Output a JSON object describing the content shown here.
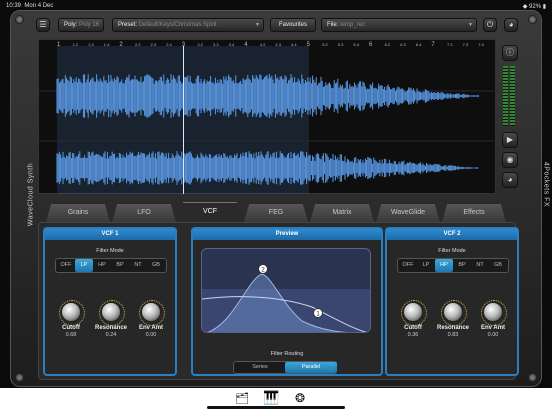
{
  "status": {
    "time": "10:39",
    "date": "Mon 4 Dec",
    "battery": "92%"
  },
  "topbar": {
    "menu_icon": "hamburger-icon",
    "poly_label": "Poly:",
    "poly_value": "Poly 16",
    "preset_label": "Preset:",
    "preset_value": "Default/Keys/Christmas Spirit",
    "favourites_label": "Favourites",
    "file_label": "File:",
    "file_value": "temp_rec"
  },
  "side_labels": {
    "left": "WaveCloud Synth",
    "right": "4Pockets FX"
  },
  "ruler": [
    "1",
    "1.2",
    "1.3",
    "1.4",
    "2",
    "2.2",
    "2.3",
    "2.4",
    "3",
    "3.2",
    "3.3",
    "3.4",
    "4",
    "4.2",
    "4.3",
    "4.4",
    "5",
    "5.2",
    "5.3",
    "5.4",
    "6",
    "6.2",
    "6.3",
    "6.4",
    "7",
    "7.2",
    "7.3",
    "7.4"
  ],
  "tabs": [
    {
      "label": "Grains",
      "active": false
    },
    {
      "label": "LFO",
      "active": false
    },
    {
      "label": "VCF",
      "active": true
    },
    {
      "label": "FEG",
      "active": false
    },
    {
      "label": "Matrix",
      "active": false
    },
    {
      "label": "WaveGlide",
      "active": false
    },
    {
      "label": "Effects",
      "active": false
    }
  ],
  "vcf1": {
    "title": "VCF 1",
    "mode_label": "Filter Mode",
    "modes": [
      "OFF",
      "LP",
      "HP",
      "BP",
      "NT",
      "GB"
    ],
    "selected_mode": "LP",
    "knobs": [
      {
        "name": "Cutoff",
        "value": "0.68"
      },
      {
        "name": "Resonance",
        "value": "0.24"
      },
      {
        "name": "Env Amt",
        "value": "0.00"
      }
    ]
  },
  "preview": {
    "title": "Preview",
    "routing_label": "Filter Routing",
    "routing_options": [
      "Series",
      "Parallel"
    ],
    "routing_selected": "Parallel",
    "markers": [
      "1",
      "2"
    ]
  },
  "vcf2": {
    "title": "VCF 2",
    "mode_label": "Filter Mode",
    "modes": [
      "OFF",
      "LP",
      "HP",
      "BP",
      "NT",
      "GB"
    ],
    "selected_mode": "HP",
    "knobs": [
      {
        "name": "Cutoff",
        "value": "0.36"
      },
      {
        "name": "Resonance",
        "value": "0.83"
      },
      {
        "name": "Env Amt",
        "value": "0.00"
      }
    ]
  },
  "colors": {
    "accent": "#2a7fc0",
    "waveform": "#5b9be8",
    "panel": "#2a2a2a"
  }
}
